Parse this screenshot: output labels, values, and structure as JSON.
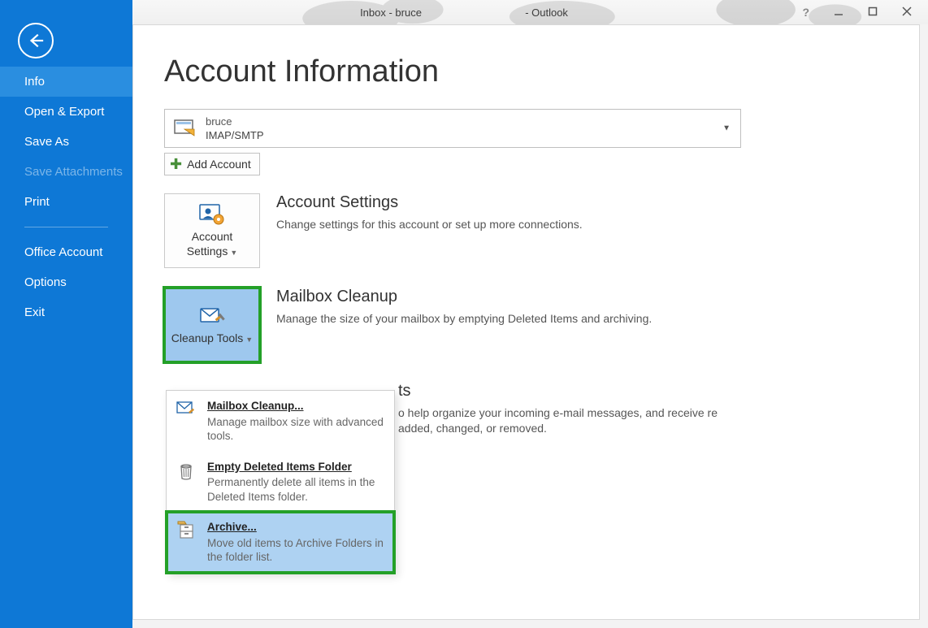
{
  "window": {
    "title_left": "Inbox - bruce",
    "title_right": "- Outlook"
  },
  "sidebar": {
    "items": [
      {
        "label": "Info",
        "selected": true,
        "disabled": false
      },
      {
        "label": "Open & Export",
        "selected": false,
        "disabled": false
      },
      {
        "label": "Save As",
        "selected": false,
        "disabled": false
      },
      {
        "label": "Save Attachments",
        "selected": false,
        "disabled": true
      },
      {
        "label": "Print",
        "selected": false,
        "disabled": false
      },
      {
        "label": "Office Account",
        "selected": false,
        "disabled": false
      },
      {
        "label": "Options",
        "selected": false,
        "disabled": false
      },
      {
        "label": "Exit",
        "selected": false,
        "disabled": false
      }
    ]
  },
  "page": {
    "title": "Account Information",
    "account": {
      "name": "bruce",
      "protocol": "IMAP/SMTP"
    },
    "add_account_label": "Add Account",
    "sections": {
      "account_settings": {
        "card_label": "Account Settings",
        "title": "Account Settings",
        "desc": "Change settings for this account or set up more connections."
      },
      "mailbox_cleanup": {
        "card_label": "Cleanup Tools",
        "title": "Mailbox Cleanup",
        "desc": "Manage the size of your mailbox by emptying Deleted Items and archiving."
      },
      "rules": {
        "title_fragment": "ts",
        "desc": "o help organize your incoming e-mail messages, and receive re added, changed, or removed."
      }
    }
  },
  "dropdown": {
    "items": [
      {
        "title": "Mailbox Cleanup...",
        "desc": "Manage mailbox size with advanced tools."
      },
      {
        "title": "Empty Deleted Items Folder",
        "desc": "Permanently delete all items in the Deleted Items folder."
      },
      {
        "title": "Archive...",
        "desc": "Move old items to Archive Folders in the folder list."
      }
    ]
  }
}
